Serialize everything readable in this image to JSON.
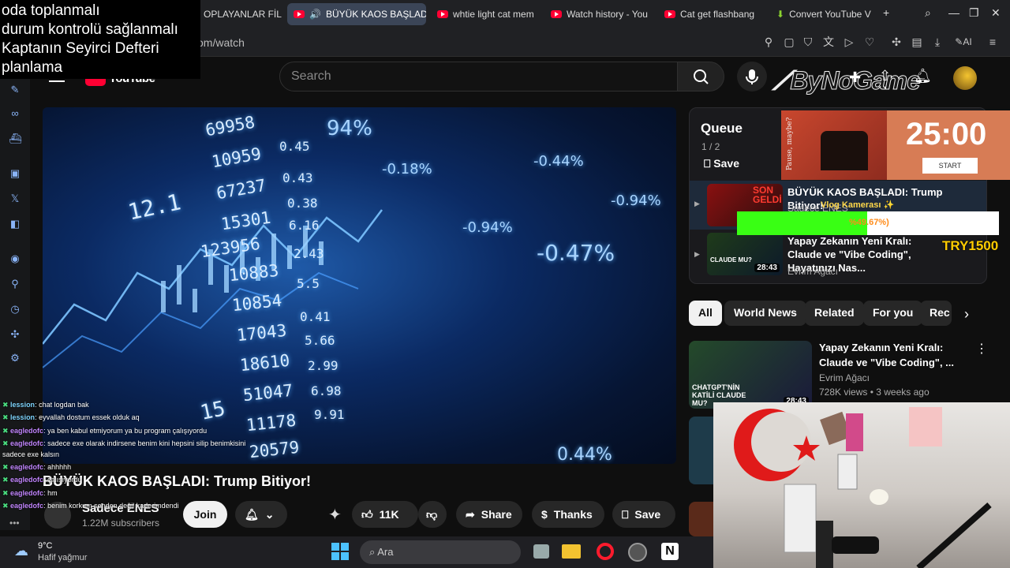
{
  "overlay_note": {
    "lines": [
      "oda toplanmalı",
      "durum kontrolü sağlanmalı",
      "Kaptanın Seyirci Defteri",
      "planlama"
    ]
  },
  "browser": {
    "tabs": [
      {
        "label": "OPLAYANLAR FİL",
        "active": false
      },
      {
        "label": "BÜYÜK KAOS BAŞLAD",
        "active": true
      },
      {
        "label": "whtie light cat mem",
        "active": false
      },
      {
        "label": "Watch history - You",
        "active": false
      },
      {
        "label": "Cat get flashbang",
        "active": false
      },
      {
        "label": "Convert YouTube V",
        "active": false
      }
    ],
    "new_tab": "+",
    "address": "om/watch",
    "ai_label": "AI"
  },
  "youtube": {
    "logo_text": "YouTube",
    "search_placeholder": "Search",
    "video": {
      "title": "BÜYÜK KAOS BAŞLADI: Trump Bitiyor!",
      "numbers": [
        "69958",
        "10959",
        "67237",
        "15301",
        "123956",
        "10883",
        "10854",
        "17043",
        "18610",
        "51047",
        "11178",
        "20579",
        "0.45",
        "0.43",
        "0.38",
        "6.16",
        "2.43",
        "5.5",
        "0.41",
        "5.66",
        "2.99",
        "6.98",
        "9.91",
        "12.1",
        "15"
      ],
      "percents": [
        "-0.18%",
        "-0.44%",
        "-0.94%",
        "-0.94%",
        "-0.47%",
        "0.44%",
        "94%"
      ]
    },
    "channel": {
      "name": "Sadece ENES",
      "subscribers": "1.22M subscribers",
      "join": "Join"
    },
    "actions": {
      "likes": "11K",
      "share": "Share",
      "thanks": "Thanks",
      "save": "Save"
    },
    "queue": {
      "title": "Queue",
      "count": "1 / 2",
      "save": "Save",
      "items": [
        {
          "title": "BÜYÜK KAOS BAŞLADI: Trump Bitiyor!",
          "channel": "Sadece ENES",
          "thumb_text": "SON GELDİ"
        },
        {
          "title": "Yapay Zekanın Yeni Kralı: Claude ve \"Vibe Coding\", Hayatınızı Nas...",
          "channel": "Evrim Ağacı",
          "duration": "28:43",
          "thumb_text": "CLAUDE MU?"
        }
      ]
    },
    "chips": [
      "All",
      "World News",
      "Related",
      "For you",
      "Rec"
    ],
    "recommendation": {
      "title": "Yapay Zekanın Yeni Kralı: Claude ve \"Vibe Coding\", ...",
      "channel": "Evrim Ağacı",
      "meta": "728K views • 3 weeks ago",
      "duration": "28:43",
      "thumb_text": "CHATGPT'NİN KATİLİ CLAUDE MU?"
    }
  },
  "stream_overlay": {
    "brand": "ByNoGame",
    "timer": "25:00",
    "timer_button": "START",
    "timer_side_text": "Pause, maybe?",
    "vlog_label": "Vlog Kamerası ✨",
    "progress_text": "%49.67%)",
    "progress_fraction": 0.4967,
    "donation": "TRY1500"
  },
  "chat": [
    {
      "user": "lession",
      "text": ": chat logdan bak"
    },
    {
      "user": "lession",
      "text": ": eyvallah dostum essek olduk aq"
    },
    {
      "user": "eagledofc",
      "text": ": ya ben kabul etmiyorum ya bu program çalışıyordu"
    },
    {
      "user": "eagledofc",
      "text": ": sadece exe olarak indirsene benim kini hepsini silip benimkisini"
    },
    {
      "user": "",
      "text": "sadece exe kalsın"
    },
    {
      "user": "eagledofc",
      "text": ": ahhhhh"
    },
    {
      "user": "eagledofc",
      "text": ": çalışıyordu"
    },
    {
      "user": "eagledofc",
      "text": ": hm"
    },
    {
      "user": "eagledofc",
      "text": ": benim korkum senden değil kaderimdendi"
    }
  ],
  "taskbar": {
    "weather_temp": "9°C",
    "weather_desc": "Hafif yağmur",
    "search": "Ara"
  },
  "colors": {
    "accent": "#3ea6ff",
    "yt_red": "#ff0033",
    "progress_green": "#39ff14",
    "timer_bg": "#d77c55"
  }
}
